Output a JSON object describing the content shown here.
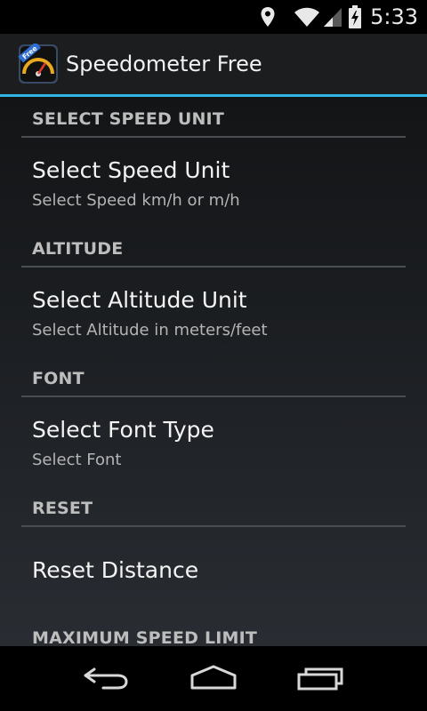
{
  "status_bar": {
    "time": "5:33",
    "icons": [
      "location-icon",
      "wifi-icon",
      "signal-icon",
      "battery-charging-icon"
    ]
  },
  "action_bar": {
    "app_icon": "speedometer-app-icon",
    "app_icon_badge": "Free",
    "title": "Speedometer Free"
  },
  "preferences": {
    "speed_unit": {
      "category": "SELECT SPEED UNIT",
      "title": "Select Speed Unit",
      "summary": "Select Speed km/h or m/h"
    },
    "altitude": {
      "category": "ALTITUDE",
      "title": "Select Altitude Unit",
      "summary": "Select Altitude in meters/feet"
    },
    "font": {
      "category": "FONT",
      "title": "Select Font Type",
      "summary": "Select Font"
    },
    "reset": {
      "category": "RESET",
      "title": "Reset Distance"
    },
    "max_speed": {
      "category": "MAXIMUM SPEED LIMIT"
    }
  },
  "nav_bar": {
    "buttons": [
      "back-icon",
      "home-icon",
      "recent-apps-icon"
    ]
  },
  "colors": {
    "accent": "#33b5e5",
    "action_bar": "#1b1d1f",
    "category_text": "#bdbdbd",
    "title_text": "#f4f4f4",
    "summary_text": "#b4b4b4"
  }
}
